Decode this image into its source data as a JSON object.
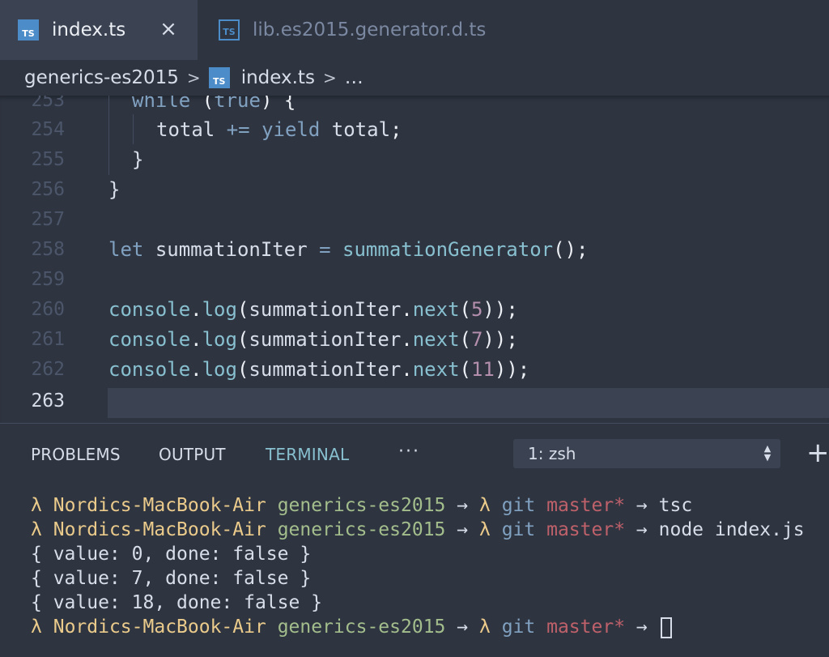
{
  "tabs": [
    {
      "icon": "ts-icon",
      "label": "index.ts",
      "active": true,
      "close": "×"
    },
    {
      "icon": "ts-icon",
      "label": "lib.es2015.generator.d.ts",
      "active": false
    }
  ],
  "ts_icon_text": "TS",
  "breadcrumb": {
    "folder": "generics-es2015",
    "file": "index.ts",
    "more": "…",
    "separator": ">"
  },
  "editor": {
    "lines": [
      {
        "number": "253",
        "code": "while (true) {"
      },
      {
        "number": "254",
        "code": "total += yield total;"
      },
      {
        "number": "255",
        "code": "}"
      },
      {
        "number": "256",
        "code": "}"
      },
      {
        "number": "257",
        "code": ""
      },
      {
        "number": "258",
        "code": "let summationIter = summationGenerator();"
      },
      {
        "number": "259",
        "code": ""
      },
      {
        "number": "260",
        "code": "console.log(summationIter.next(5));"
      },
      {
        "number": "261",
        "code": "console.log(summationIter.next(7));"
      },
      {
        "number": "262",
        "code": "console.log(summationIter.next(11));"
      },
      {
        "number": "263",
        "code": ""
      }
    ],
    "current_line": "263"
  },
  "panel": {
    "tabs": [
      "PROBLEMS",
      "OUTPUT",
      "TERMINAL"
    ],
    "active_tab": "TERMINAL",
    "more": "···",
    "terminal_select": "1: zsh",
    "add": "+"
  },
  "terminal": {
    "prompt": {
      "lambda": "λ",
      "host": "Nordics-MacBook-Air",
      "dir": "generics-es2015",
      "arrow": "→",
      "git": "git",
      "branch": "master*"
    },
    "commands": [
      "tsc",
      "node index.js",
      ""
    ],
    "outputs": [
      "{ value: 0, done: false }",
      "{ value: 7, done: false }",
      "{ value: 18, done: false }"
    ]
  },
  "colors": {
    "background": "#2e3440",
    "keyword": "#81a1c1",
    "function": "#88c0d0",
    "number": "#b48ead",
    "prompt_yellow": "#ebcb8b",
    "prompt_green": "#a3be8c",
    "branch_red": "#bf616a"
  }
}
